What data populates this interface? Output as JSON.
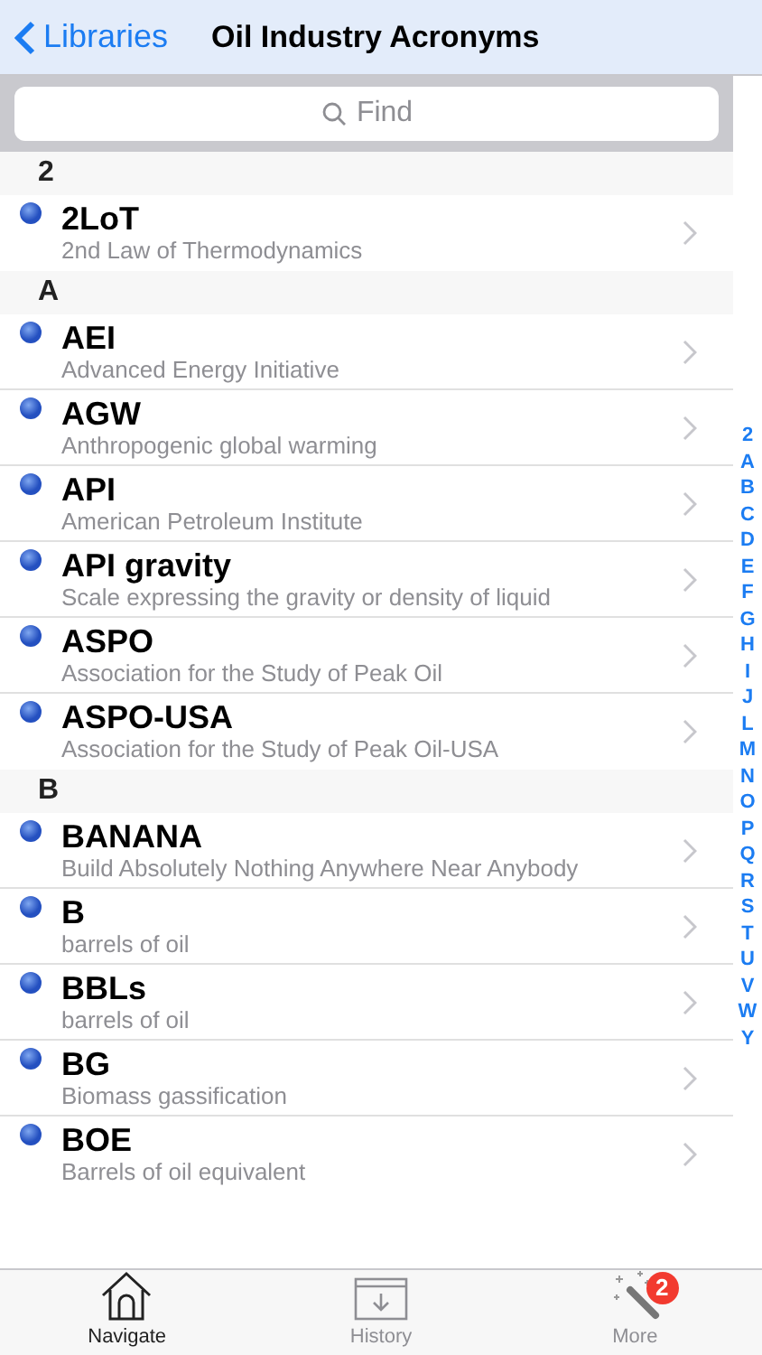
{
  "nav": {
    "back": "Libraries",
    "title": "Oil Industry Acronyms"
  },
  "search": {
    "placeholder": "Find"
  },
  "sections": [
    {
      "header": "2",
      "items": [
        {
          "term": "2LoT",
          "definition": "2nd Law of Thermodynamics"
        }
      ]
    },
    {
      "header": "A",
      "items": [
        {
          "term": "AEI",
          "definition": "Advanced Energy Initiative"
        },
        {
          "term": "AGW",
          "definition": "Anthropogenic global warming"
        },
        {
          "term": "API",
          "definition": "American Petroleum Institute"
        },
        {
          "term": "API gravity",
          "definition": "Scale expressing the gravity or density of liquid"
        },
        {
          "term": "ASPO",
          "definition": "Association for the Study of Peak Oil"
        },
        {
          "term": "ASPO-USA",
          "definition": "Association for the Study of Peak Oil-USA"
        }
      ]
    },
    {
      "header": "B",
      "items": [
        {
          "term": "BANANA",
          "definition": "Build Absolutely Nothing Anywhere Near Anybody"
        },
        {
          "term": "B",
          "definition": "barrels of oil"
        },
        {
          "term": "BBLs",
          "definition": "barrels of oil"
        },
        {
          "term": "BG",
          "definition": "Biomass gassification"
        },
        {
          "term": "BOE",
          "definition": "Barrels of oil equivalent"
        }
      ]
    }
  ],
  "index": [
    "2",
    "A",
    "B",
    "C",
    "D",
    "E",
    "F",
    "G",
    "H",
    "I",
    "J",
    "L",
    "M",
    "N",
    "O",
    "P",
    "Q",
    "R",
    "S",
    "T",
    "U",
    "V",
    "W",
    "Y"
  ],
  "tabs": [
    {
      "label": "Navigate",
      "kind": "home",
      "selected": true
    },
    {
      "label": "History",
      "kind": "history",
      "selected": false
    },
    {
      "label": "More",
      "kind": "more",
      "selected": false,
      "badge": "2"
    }
  ]
}
